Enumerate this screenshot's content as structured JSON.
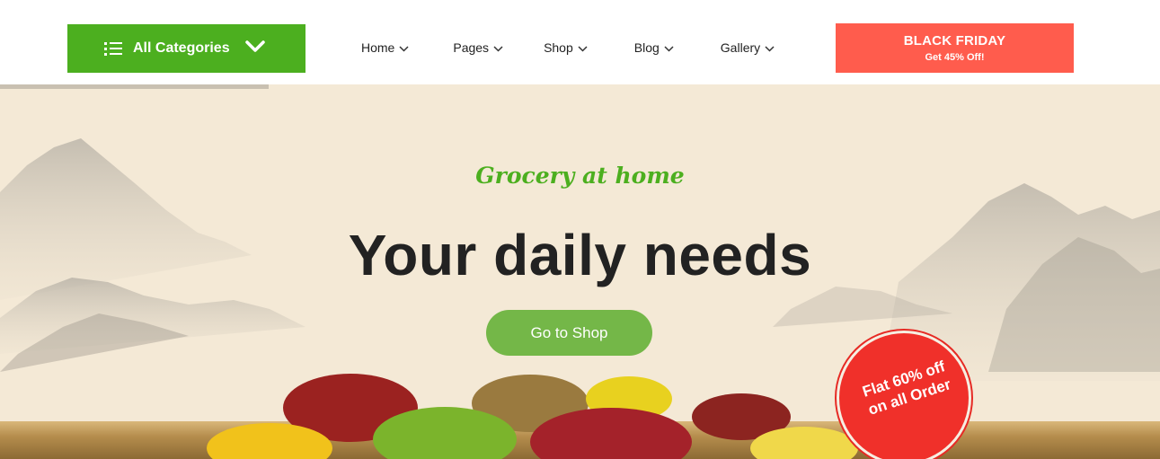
{
  "header": {
    "categories_label": "All Categories",
    "menu": [
      {
        "label": "Home"
      },
      {
        "label": "Pages"
      },
      {
        "label": "Shop"
      },
      {
        "label": "Blog"
      },
      {
        "label": "Gallery"
      }
    ],
    "promo": {
      "title": "BLACK FRIDAY",
      "subtitle": "Get 45% Off!"
    }
  },
  "hero": {
    "tagline": "Grocery at home",
    "headline": "Your daily needs",
    "cta_label": "Go to Shop",
    "badge_line1": "Flat 60% off",
    "badge_line2": "on all Order"
  },
  "colors": {
    "brand_green": "#4caf1f",
    "cta_green": "#74b748",
    "promo_red": "#ff5c4d",
    "badge_red": "#f0302a",
    "hero_bg": "#f4e9d6"
  },
  "icons": {
    "categories": "list-icon",
    "categories_toggle": "chevron-down-icon",
    "menu_dropdown": "chevron-down-icon"
  }
}
